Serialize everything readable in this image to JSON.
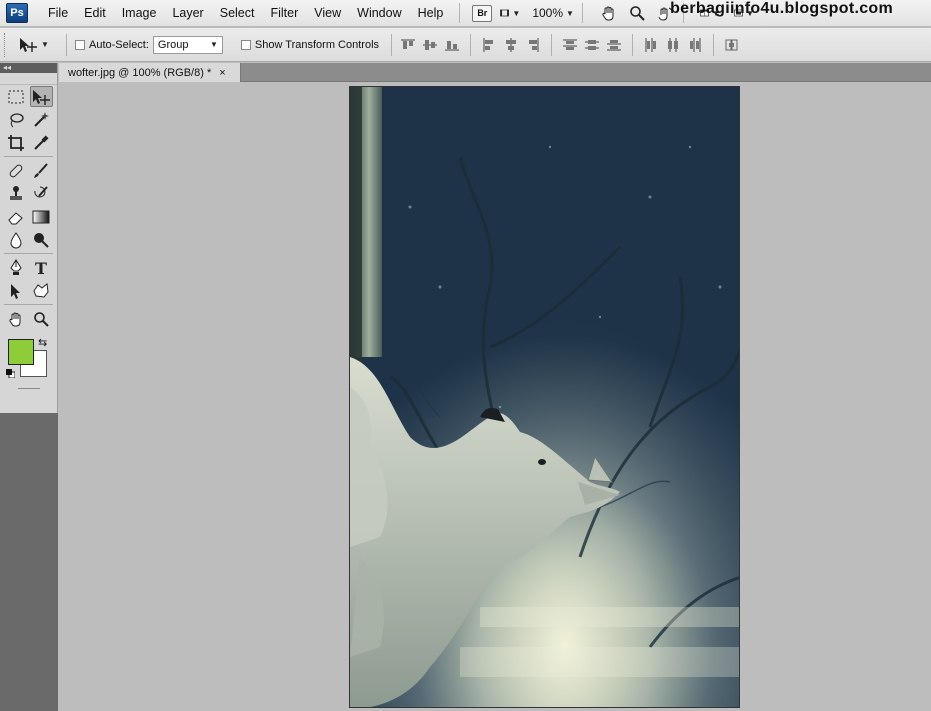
{
  "app": {
    "logo": "Ps"
  },
  "menu": [
    "File",
    "Edit",
    "Image",
    "Layer",
    "Select",
    "Filter",
    "View",
    "Window",
    "Help"
  ],
  "menubar": {
    "bridge_label": "Br",
    "zoom": "100%"
  },
  "options": {
    "auto_select_label": "Auto-Select:",
    "auto_select_value": "Group",
    "show_transform_label": "Show Transform Controls"
  },
  "tools_panel": {
    "collapse_label": "◂◂"
  },
  "colors": {
    "foreground": "#8fcc3a",
    "background": "#ffffff"
  },
  "document": {
    "tab_title": "wofter.jpg @ 100% (RGB/8) *",
    "close_glyph": "×"
  },
  "watermark": "berbagiinfo4u.blogspot.com"
}
